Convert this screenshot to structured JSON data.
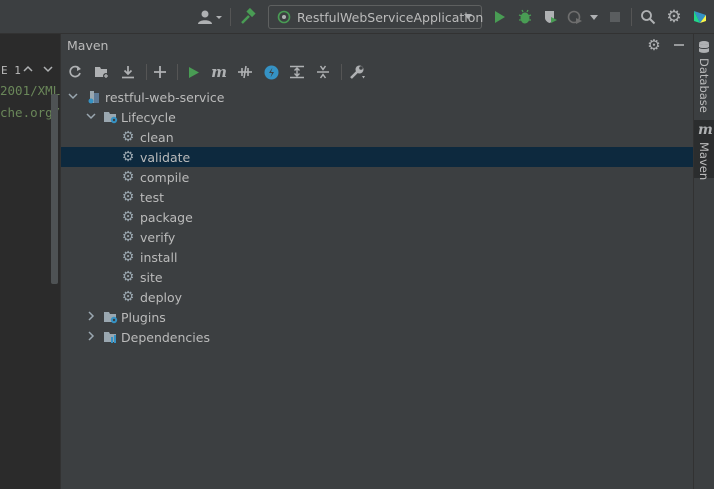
{
  "topbar": {
    "run_config_label": "RestfulWebServiceApplication"
  },
  "editor": {
    "line1": "E 1",
    "line2": "2001/XML",
    "line3": "che.org/"
  },
  "maven": {
    "title": "Maven",
    "project": "restful-web-service",
    "lifecycle_label": "Lifecycle",
    "goals": [
      "clean",
      "validate",
      "compile",
      "test",
      "package",
      "verify",
      "install",
      "site",
      "deploy"
    ],
    "plugins_label": "Plugins",
    "dependencies_label": "Dependencies"
  },
  "sidebar": {
    "database_label": "Database",
    "maven_label": "Maven",
    "maven_icon_text": "m"
  },
  "colors": {
    "selection": "#0d293e",
    "run_green": "#499c54",
    "accent_blue": "#3592c4"
  }
}
